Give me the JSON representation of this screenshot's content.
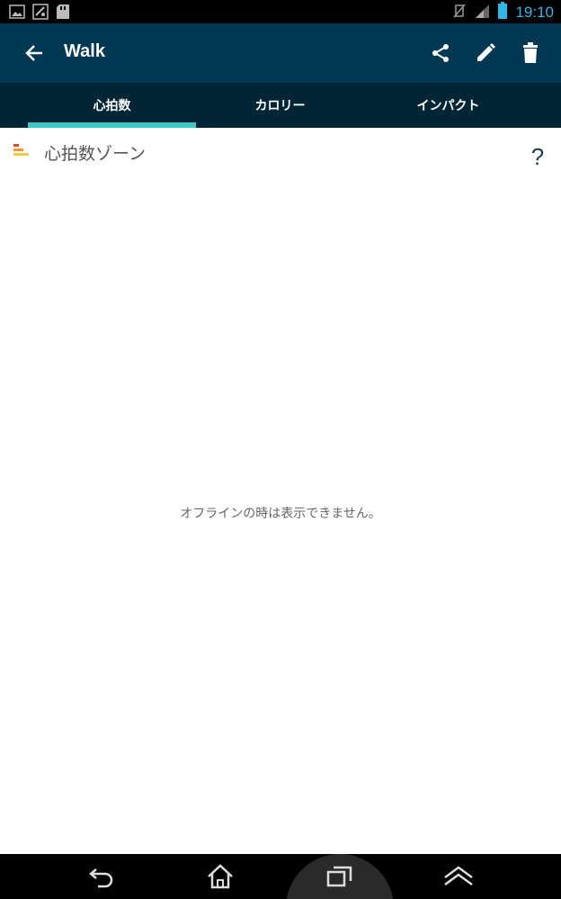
{
  "status_bar": {
    "time": "19:10",
    "time_color": "#33b5e5",
    "left_icons": [
      "gallery-icon",
      "gallery-sync-icon",
      "sd-card-icon"
    ],
    "right_icons": [
      "vibrate-off-icon",
      "signal-icon",
      "battery-icon"
    ]
  },
  "app_bar": {
    "title": "Walk",
    "background": "#003854",
    "actions": [
      "share-icon",
      "edit-icon",
      "delete-icon"
    ]
  },
  "tabs": {
    "items": [
      {
        "label": "心拍数",
        "selected": true
      },
      {
        "label": "カロリー",
        "selected": false
      },
      {
        "label": "インパクト",
        "selected": false
      }
    ],
    "indicator_color": "#3ec6c0"
  },
  "section": {
    "title": "心拍数ゾーン",
    "help_label": "?"
  },
  "content": {
    "message": "オフラインの時は表示できません。"
  },
  "nav_bar": {
    "buttons": [
      "back-icon",
      "home-icon",
      "recent-apps-icon",
      "menu-icon"
    ]
  }
}
